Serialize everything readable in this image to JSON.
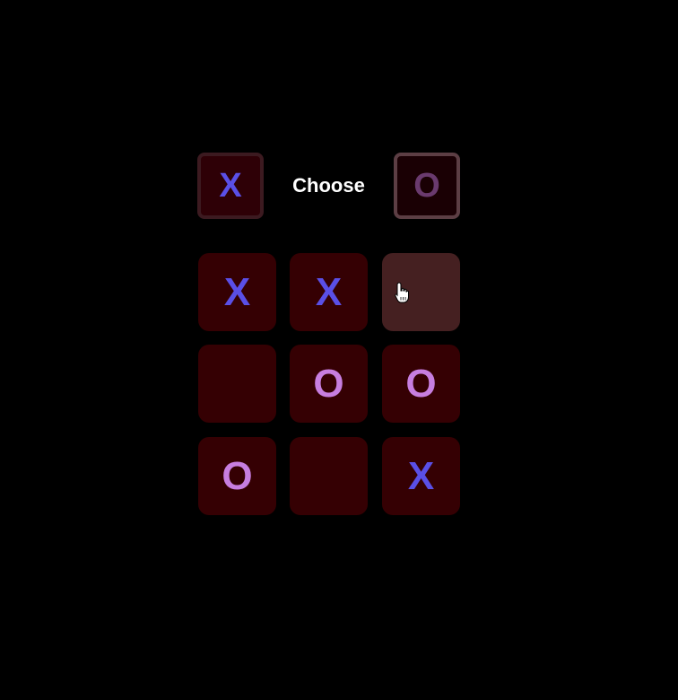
{
  "chooser": {
    "x_label": "X",
    "prompt": "Choose",
    "o_label": "O"
  },
  "board": {
    "cells": [
      {
        "mark": "X"
      },
      {
        "mark": "X"
      },
      {
        "mark": ""
      },
      {
        "mark": ""
      },
      {
        "mark": "O"
      },
      {
        "mark": "O"
      },
      {
        "mark": "O"
      },
      {
        "mark": ""
      },
      {
        "mark": "X"
      }
    ]
  },
  "colors": {
    "background": "#000000",
    "cell": "#350003",
    "cell_hover": "#452021",
    "x_mark": "#5a4fe6",
    "o_mark": "#c77ee0"
  },
  "icons": {
    "cursor": "hand-pointer-icon"
  }
}
